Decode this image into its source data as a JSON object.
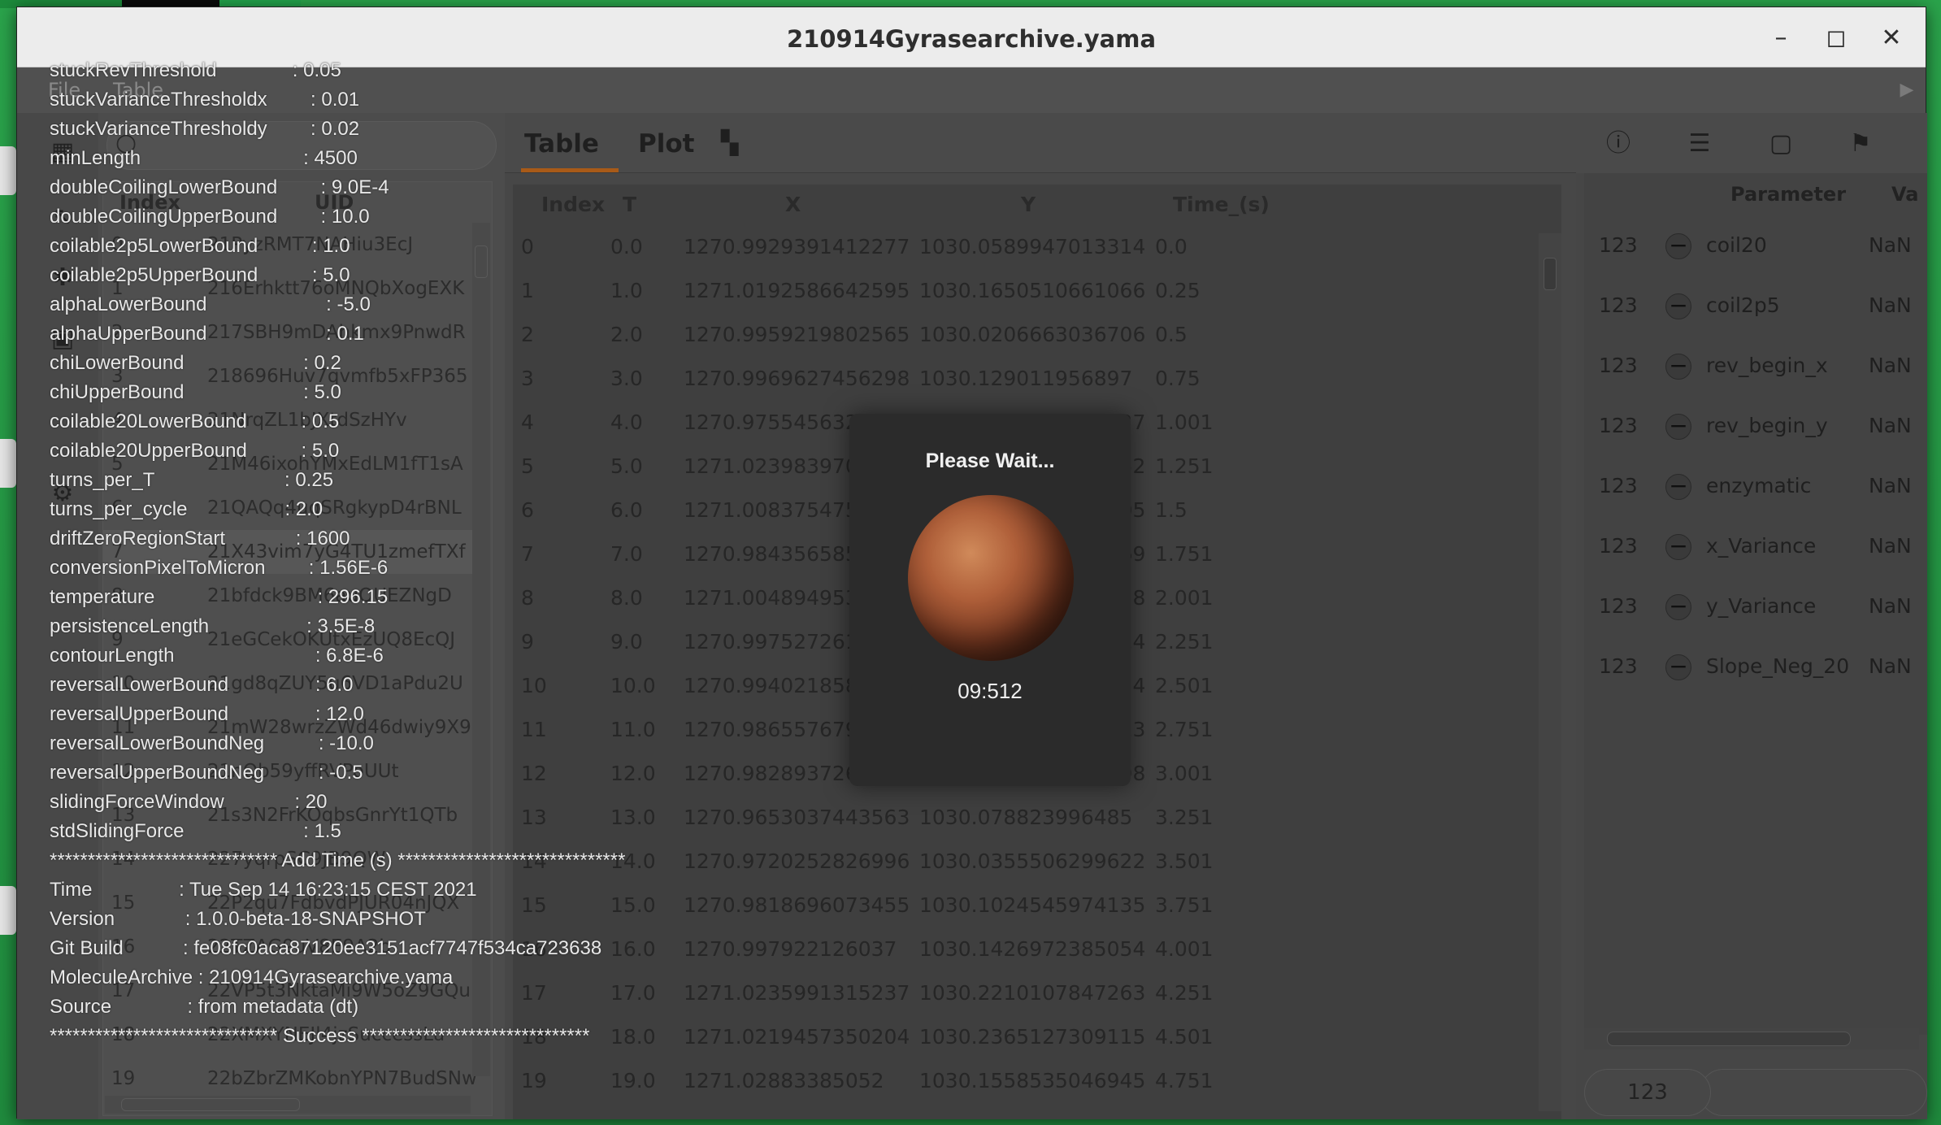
{
  "window": {
    "title": "210914Gyrasearchive.yama",
    "minimize_glyph": "–",
    "maximize_glyph": "◻",
    "close_glyph": "✕"
  },
  "menu": {
    "file": "File",
    "table": "Table"
  },
  "left_table": {
    "headers": {
      "index": "Index",
      "uid": "UID"
    },
    "rows": [
      {
        "index": "0",
        "uid": "21PyzRMT7NAHiu3EcJ"
      },
      {
        "index": "1",
        "uid": "216Erhktt76oMNQbXogEXK"
      },
      {
        "index": "2",
        "uid": "217SBH9mDAhkmx9PnwdR"
      },
      {
        "index": "3",
        "uid": "218696Huv7qvmfb5xFP365"
      },
      {
        "index": "4",
        "uid": "21NrqZL1bJXtdSzHYv"
      },
      {
        "index": "5",
        "uid": "21M46ixohYMxEdLM1fT1sA"
      },
      {
        "index": "6",
        "uid": "21QAQq4uqSRgkypD4rBNL"
      },
      {
        "index": "7",
        "uid": "21X43vim7yG4TU1zmefTXf"
      },
      {
        "index": "8",
        "uid": "21bfdck9BM6auQUEZNgD"
      },
      {
        "index": "9",
        "uid": "21eGCekOKUtxEzUQ8EcQJ"
      },
      {
        "index": "10",
        "uid": "21gd8qZUY5u6VD1aPdu2U"
      },
      {
        "index": "11",
        "uid": "21mW28wrzZWd46dwiy9X93"
      },
      {
        "index": "12",
        "uid": "21nQb59yffRVPoUUt"
      },
      {
        "index": "13",
        "uid": "21s3N2FrKOqbsGnrYt1QTb"
      },
      {
        "index": "14",
        "uid": "227yqrpSC9JB9QW"
      },
      {
        "index": "15",
        "uid": "22P2qu7FdbvdPJUR04nJQX"
      },
      {
        "index": "16",
        "uid": "22TZAG9uV8E9A2b"
      },
      {
        "index": "17",
        "uid": "22VP5t3NktaMi9W5oZ9GQu"
      },
      {
        "index": "18",
        "uid": "22XMXYNEJl4jzSuccessLu"
      },
      {
        "index": "19",
        "uid": "22bZbrZMKobnYPN7BudSNw"
      }
    ]
  },
  "center": {
    "tabs": {
      "table": "Table",
      "plot": "Plot"
    },
    "headers": {
      "index": "Index",
      "t": "T",
      "x": "X",
      "y": "Y",
      "time": "Time_(s)"
    },
    "rows": [
      {
        "index": "0",
        "t": "0.0",
        "x": "1270.9929391412277",
        "y": "1030.0589947013314",
        "time": "0.0"
      },
      {
        "index": "1",
        "t": "1.0",
        "x": "1271.0192586642595",
        "y": "1030.1650510661066",
        "time": "0.25"
      },
      {
        "index": "2",
        "t": "2.0",
        "x": "1270.9959219802565",
        "y": "1030.0206663036706",
        "time": "0.5"
      },
      {
        "index": "3",
        "t": "3.0",
        "x": "1270.9969627456298",
        "y": "1030.129011956897",
        "time": "0.75"
      },
      {
        "index": "4",
        "t": "4.0",
        "x": "1270.9755456321943",
        "y": "1030.1540904709227",
        "time": "1.001"
      },
      {
        "index": "5",
        "t": "5.0",
        "x": "1271.0239839704893",
        "y": "1030.0960740931352",
        "time": "1.251"
      },
      {
        "index": "6",
        "t": "6.0",
        "x": "1271.0083754755055",
        "y": "1030.1027627932805",
        "time": "1.5"
      },
      {
        "index": "7",
        "t": "7.0",
        "x": "1270.9843565856838",
        "y": "1030.1042871332269",
        "time": "1.751"
      },
      {
        "index": "8",
        "t": "8.0",
        "x": "1271.0048949534516",
        "y": "1030.0955287521528",
        "time": "2.001"
      },
      {
        "index": "9",
        "t": "9.0",
        "x": "1270.99752726141",
        "y": "1030.1030523667314",
        "time": "2.251"
      },
      {
        "index": "10",
        "t": "10.0",
        "x": "1270.9940218584481",
        "y": "1030.1512882868724",
        "time": "2.501"
      },
      {
        "index": "11",
        "t": "11.0",
        "x": "1270.9865576797867",
        "y": "1030.1121097003813",
        "time": "2.751"
      },
      {
        "index": "12",
        "t": "12.0",
        "x": "1270.9828937265596",
        "y": "1030.0598095771898",
        "time": "3.001"
      },
      {
        "index": "13",
        "t": "13.0",
        "x": "1270.9653037443563",
        "y": "1030.078823996485",
        "time": "3.251"
      },
      {
        "index": "14",
        "t": "14.0",
        "x": "1270.9720252826996",
        "y": "1030.0355506299622",
        "time": "3.501"
      },
      {
        "index": "15",
        "t": "15.0",
        "x": "1270.9818696073455",
        "y": "1030.1024545974135",
        "time": "3.751"
      },
      {
        "index": "16",
        "t": "16.0",
        "x": "1270.997922126037",
        "y": "1030.1426972385054",
        "time": "4.001"
      },
      {
        "index": "17",
        "t": "17.0",
        "x": "1271.0235991315237",
        "y": "1030.2210107847263",
        "time": "4.251"
      },
      {
        "index": "18",
        "t": "18.0",
        "x": "1271.0219457350204",
        "y": "1030.2365127309115",
        "time": "4.501"
      },
      {
        "index": "19",
        "t": "19.0",
        "x": "1271.02883385052",
        "y": "1030.1558535046945",
        "time": "4.751"
      }
    ]
  },
  "right": {
    "headers": {
      "parameter": "Parameter",
      "value": "Va"
    },
    "rows": [
      {
        "type": "123",
        "name": "coil20",
        "value": "NaN"
      },
      {
        "type": "123",
        "name": "coil2p5",
        "value": "NaN"
      },
      {
        "type": "123",
        "name": "rev_begin_x",
        "value": "NaN"
      },
      {
        "type": "123",
        "name": "rev_begin_y",
        "value": "NaN"
      },
      {
        "type": "123",
        "name": "enzymatic",
        "value": "NaN"
      },
      {
        "type": "123",
        "name": "x_Variance",
        "value": "NaN"
      },
      {
        "type": "123",
        "name": "y_Variance",
        "value": "NaN"
      },
      {
        "type": "123",
        "name": "Slope_Neg_20",
        "value": "NaN"
      }
    ],
    "bottom_box": "123"
  },
  "log": [
    "stuckRevThreshold              : 0.05",
    "stuckVarianceThresholdx        : 0.01",
    "stuckVarianceThresholdy        : 0.02",
    "minLength                              : 4500",
    "doubleCoilingLowerBound        : 9.0E-4",
    "doubleCoilingUpperBound        : 10.0",
    "coilable2p5LowerBound          : 1.0",
    "coilable2p5UpperBound          : 5.0",
    "alphaLowerBound                      : -5.0",
    "alphaUpperBound                      : 0.1",
    "chiLowerBound                      : 0.2",
    "chiUpperBound                      : 5.0",
    "coilable20LowerBound          : 0.5",
    "coilable20UpperBound          : 5.0",
    "turns_per_T                        : 0.25",
    "turns_per_cycle                  : 2.0",
    "driftZeroRegionStart             : 1600",
    "conversionPixelToMicron        : 1.56E-6",
    "temperature                              : 296.15",
    "persistenceLength                  : 3.5E-8",
    "contourLength                          : 6.8E-6",
    "reversalLowerBound                : 6.0",
    "reversalUpperBound                : 12.0",
    "reversalLowerBoundNeg          : -10.0",
    "reversalUpperBoundNeg          : -0.5",
    "slidingForceWindow             : 20",
    "stdSlidingForce                      : 1.5",
    "****************************** Add Time (s) ******************************",
    "Time                : Tue Sep 14 16:23:15 CEST 2021",
    "Version             : 1.0.0-beta-18-SNAPSHOT",
    "Git Build           : fe08fc0aca87120ee3151acf7747f534ca723638",
    "MoleculeArchive : 210914Gyrasearchive.yama",
    "Source              : from metadata (dt)",
    "****************************** Success ******************************"
  ],
  "modal": {
    "title": "Please Wait...",
    "time": "09:512"
  }
}
